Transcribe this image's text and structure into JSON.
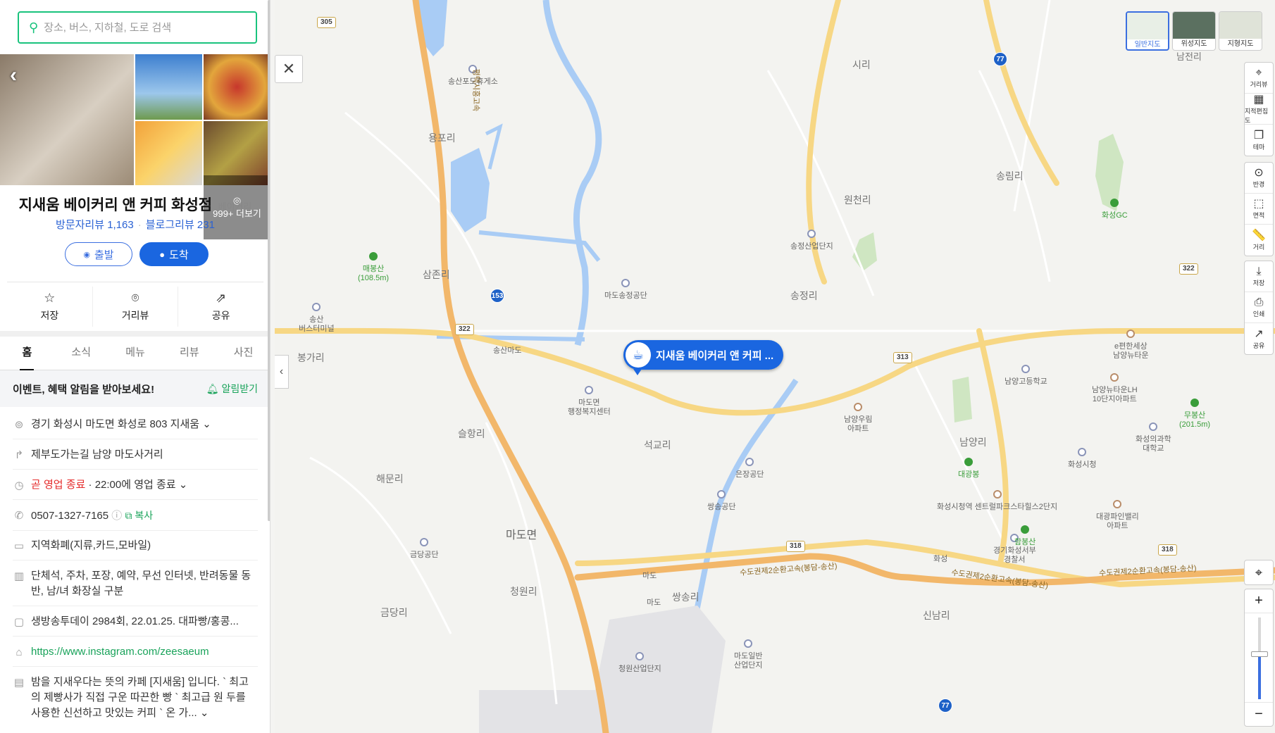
{
  "search": {
    "placeholder": "장소, 버스, 지하철, 도로 검색"
  },
  "place": {
    "name": "지새움 베이커리 앤 커피 화성점",
    "category": "베이커리",
    "visitor_reviews": "방문자리뷰 1,163",
    "blog_reviews": "블로그리뷰 231",
    "more_photos": "999+ 더보기"
  },
  "buttons": {
    "start": "출발",
    "arrive": "도착"
  },
  "actions": [
    {
      "label": "저장",
      "icon": "star-icon"
    },
    {
      "label": "거리뷰",
      "icon": "pin-icon"
    },
    {
      "label": "공유",
      "icon": "share-icon"
    }
  ],
  "tabs": [
    {
      "label": "홈",
      "active": true
    },
    {
      "label": "소식"
    },
    {
      "label": "메뉴"
    },
    {
      "label": "리뷰"
    },
    {
      "label": "사진"
    }
  ],
  "notice": {
    "text": "이벤트, 혜택 알림을 받아보세요!",
    "action": "알림받기"
  },
  "info": {
    "address": "경기 화성시 마도면 화성로 803 지새움",
    "directions": "제부도가는길 남양 마도사거리",
    "status": "곧 영업 종료",
    "hours": "22:00에 영업 종료",
    "phone": "0507-1327-7165",
    "copy": "복사",
    "payment": "지역화폐(지류,카드,모바일)",
    "amenities": "단체석, 주차, 포장, 예약, 무선 인터넷, 반려동물 동반, 남/녀 화장실 구분",
    "tv": "생방송투데이 2984회, 22.01.25. 대파빵/홍콩...",
    "website": "https://www.instagram.com/zeesaeum",
    "description": "밤을 지새우다는 뜻의 카페 [지새움] 입니다. ` 최고의 제빵사가 직접 구운 따끈한 빵 ` 최고급 원 두를 사용한 신선하고 맛있는 커피 ` 온 가..."
  },
  "map": {
    "marker_label": "지새움 베이커리 앤 커피 ...",
    "map_types": [
      "일반지도",
      "위성지도",
      "지형지도"
    ],
    "tools": [
      "거리뷰",
      "지적편집도",
      "테마",
      "반경",
      "면적",
      "거리",
      "저장",
      "인쇄",
      "공유"
    ],
    "places": {
      "siri": "시리",
      "yongpori": "용포리",
      "songnimri": "송림리",
      "woncheonri": "원천리",
      "samjonri": "삼존리",
      "songjeongri": "송정리",
      "bonggari": "봉가리",
      "seolhangri": "슬항리",
      "seokgyori": "석교리",
      "haemunri": "해문리",
      "madomyeon": "마도면",
      "namyangri": "남양리",
      "cheongwonri": "청원리",
      "ssangsongri": "쌍송리",
      "geumdangri": "금당리",
      "sinnamri": "신남리",
      "namjeonri": "남전리"
    },
    "pois": {
      "songsan_rest": "송산포도휴게소",
      "madosongjeong": "마도송정공단",
      "songjeong_ind": "송정산업단지",
      "maebongsan": "매봉산",
      "maebongsan_h": "(108.5m)",
      "songsan_terminal_1": "송산",
      "songsan_terminal_2": "버스터미널",
      "mado_office_1": "마도면",
      "mado_office_2": "행정복지센터",
      "namyang_apt_1": "남양우림",
      "namyang_apt_2": "아파트",
      "eunjang": "은장공단",
      "ssangsong": "쌍송공단",
      "geumdang": "금당공단",
      "cheongwon_ind": "청원산업단지",
      "mado_ind_1": "마도일반",
      "mado_ind_2": "산업단지",
      "hwaseong_gc": "화성GC",
      "namyang_hs": "남양고등학교",
      "hwaseong_city": "화성시청",
      "hwaseong_center": "화성시청역 센트럴파크스타힐스2단지",
      "daegwang": "대광봉",
      "police_1": "경기화성서부",
      "police_2": "경찰서",
      "hambongsan": "함봉산",
      "daegwang_apt_1": "대광파인밸리",
      "daegwang_apt_2": "아파트",
      "epyeonhan_1": "e편한세상",
      "epyeonhan_2": "남양뉴타운",
      "newtown_1": "남양뉴타운LH",
      "newtown_2": "10단지아파트",
      "muhong_1": "무봉산",
      "muhong_2": "(201.5m)",
      "hwaseong_sci_1": "화성의과학",
      "hwaseong_sci_2": "대학교"
    },
    "ic": {
      "songsan_ic": "송산마도",
      "mado_ic": "마도",
      "hwaseong_ic": "화성",
      "mado_jc": "마도"
    },
    "routes": {
      "r305": "305",
      "r322": "322",
      "r322b": "322",
      "r313": "313",
      "r318": "318",
      "r318b": "318",
      "r77": "77",
      "r77b": "77",
      "r153": "153"
    },
    "highways": {
      "h1": "평택시흥고속",
      "h2": "수도권제2순환고속(봉담-송산)",
      "h3": "수도권제2순환고속(봉담-송산)",
      "h4": "수도권제2순환고속(봉담-송산)"
    }
  },
  "colors": {
    "accent": "#1a66e0",
    "search_border": "#19c37d",
    "closing": "#e52b2b"
  }
}
